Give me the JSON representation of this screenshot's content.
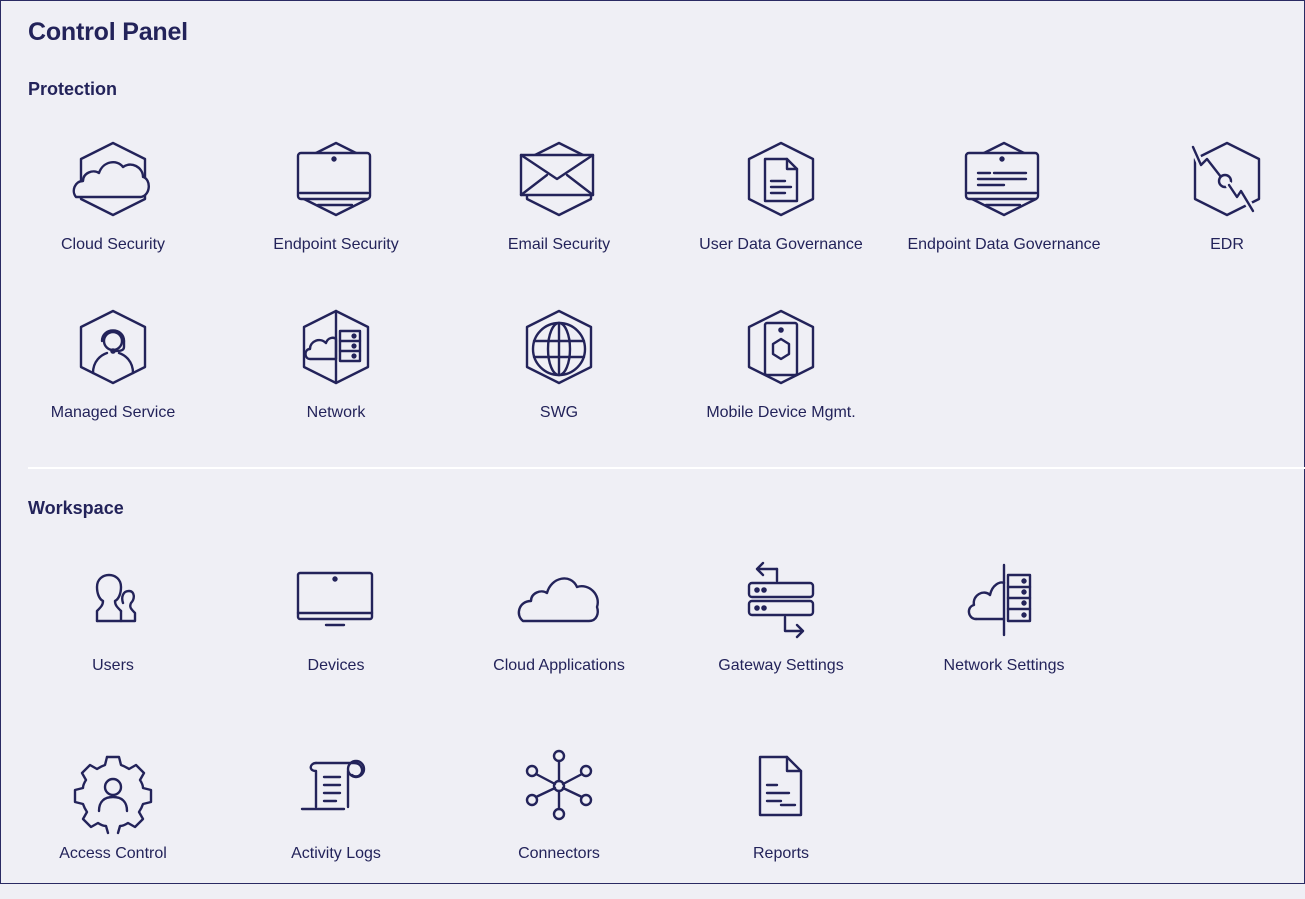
{
  "page": {
    "title": "Control Panel"
  },
  "sections": {
    "protection": {
      "title": "Protection",
      "items": [
        {
          "label": "Cloud Security",
          "icon": "cloud-hexagon-icon"
        },
        {
          "label": "Endpoint Security",
          "icon": "laptop-hexagon-icon"
        },
        {
          "label": "Email Security",
          "icon": "envelope-hexagon-icon"
        },
        {
          "label": "User Data Governance",
          "icon": "document-hexagon-icon"
        },
        {
          "label": "Endpoint Data Governance",
          "icon": "laptop-document-hexagon-icon"
        },
        {
          "label": "EDR",
          "icon": "edr-hexagon-icon"
        },
        {
          "label": "Managed Service",
          "icon": "headset-agent-hexagon-icon"
        },
        {
          "label": "Network",
          "icon": "network-hexagon-icon"
        },
        {
          "label": "SWG",
          "icon": "globe-hexagon-icon"
        },
        {
          "label": "Mobile Device Mgmt.",
          "icon": "mobile-hexagon-icon"
        }
      ]
    },
    "workspace": {
      "title": "Workspace",
      "items": [
        {
          "label": "Users",
          "icon": "users-icon"
        },
        {
          "label": "Devices",
          "icon": "monitor-icon"
        },
        {
          "label": "Cloud Applications",
          "icon": "cloud-icon"
        },
        {
          "label": "Gateway Settings",
          "icon": "gateway-servers-icon"
        },
        {
          "label": "Network Settings",
          "icon": "cloud-server-icon"
        },
        {
          "label": "Access Control",
          "icon": "gear-user-icon"
        },
        {
          "label": "Activity Logs",
          "icon": "scroll-log-icon"
        },
        {
          "label": "Connectors",
          "icon": "hub-nodes-icon"
        },
        {
          "label": "Reports",
          "icon": "report-document-icon"
        }
      ]
    }
  },
  "colors": {
    "ink": "#23235a",
    "background": "#efeff5",
    "divider": "#ffffff"
  }
}
